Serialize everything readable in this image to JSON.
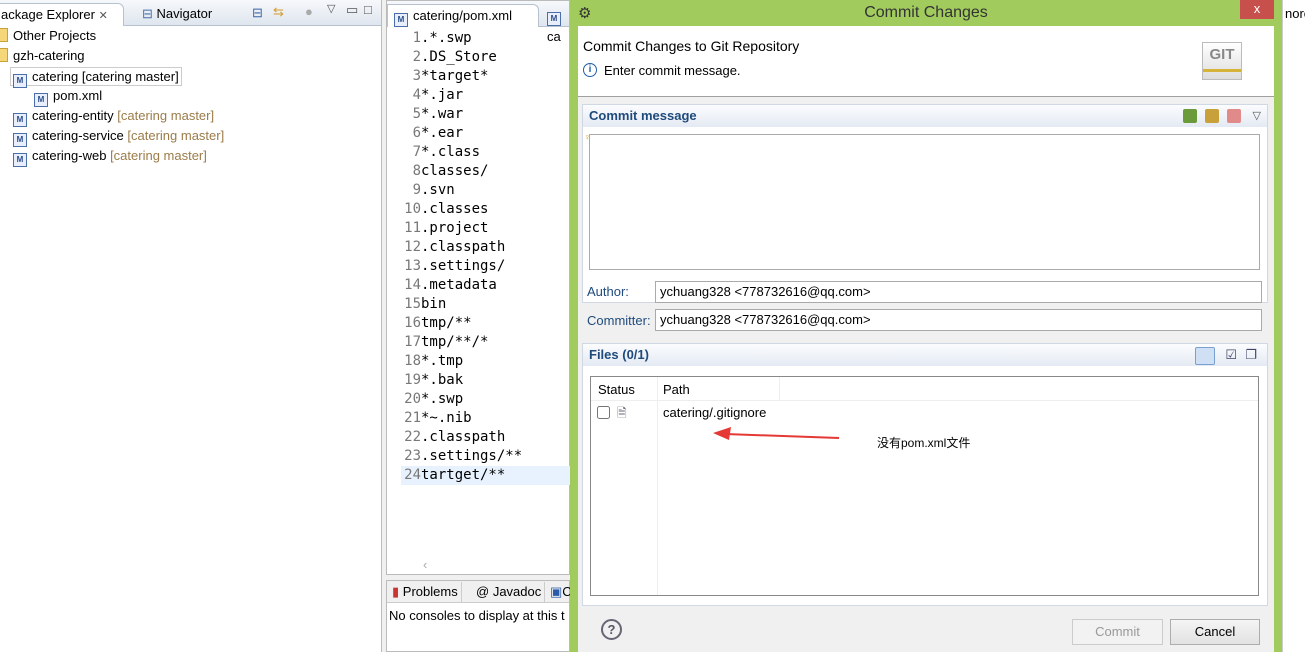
{
  "left_panel": {
    "tabs": [
      {
        "label": "ackage Explorer",
        "close": "✕"
      },
      {
        "label": "Navigator"
      }
    ],
    "tree": [
      {
        "label": "Other Projects",
        "decoration": ""
      },
      {
        "label": "gzh-catering",
        "decoration": ""
      },
      {
        "label": "catering [catering master]",
        "decoration": ""
      },
      {
        "label": "pom.xml",
        "decoration": ""
      },
      {
        "label": "catering-entity",
        "decoration": "[catering master]"
      },
      {
        "label": "catering-service",
        "decoration": "[catering master]"
      },
      {
        "label": "catering-web",
        "decoration": "[catering master]"
      }
    ]
  },
  "editor": {
    "tabs": [
      {
        "label": "catering/pom.xml"
      },
      {
        "label": "ca"
      }
    ],
    "lines": [
      ".*.swp",
      ".DS_Store",
      "*target*",
      "*.jar",
      "*.war",
      "*.ear",
      "*.class",
      "classes/",
      ".svn",
      ".classes",
      ".project",
      ".classpath",
      ".settings/",
      ".metadata",
      "bin",
      "tmp/**",
      "tmp/**/*",
      "*.tmp",
      "*.bak",
      "*.swp",
      "*~.nib",
      ".classpath",
      ".settings/**",
      "tartget/**"
    ]
  },
  "bottom_panel": {
    "tabs": [
      {
        "label": "Problems"
      },
      {
        "label": "Javadoc"
      },
      {
        "label": "C"
      }
    ],
    "message": "No consoles to display at this t"
  },
  "right_edge_text": "nore",
  "dialog": {
    "title": "Commit Changes",
    "close": "x",
    "heading": "Commit Changes to Git Repository",
    "info": "Enter commit message.",
    "logo": "GIT",
    "commit_message": {
      "label": "Commit message",
      "value": ""
    },
    "author": {
      "label": "Author:",
      "value": "ychuang328 <778732616@qq.com>"
    },
    "committer": {
      "label": "Committer:",
      "value": "ychuang328 <778732616@qq.com>"
    },
    "files": {
      "label": "Files (0/1)",
      "columns": [
        "Status",
        "Path"
      ],
      "rows": [
        {
          "checked": false,
          "path": "catering/.gitignore"
        }
      ]
    },
    "annotation": "没有pom.xml文件",
    "annotation_color": "#e53935",
    "buttons": {
      "commit": "Commit",
      "cancel": "Cancel"
    },
    "accent": "#a2cb5e"
  }
}
